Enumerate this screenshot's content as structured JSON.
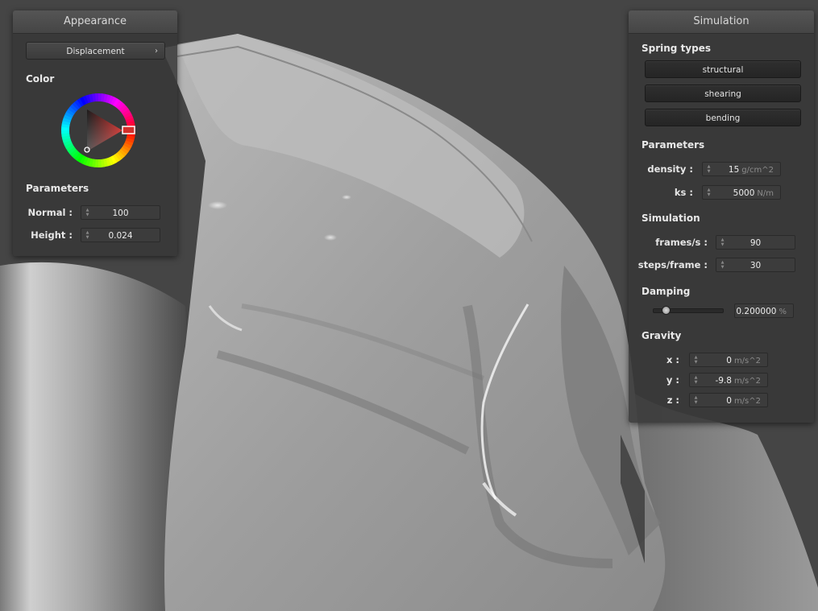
{
  "appearance": {
    "title": "Appearance",
    "shader_select": "Displacement",
    "color_label": "Color",
    "parameters_label": "Parameters",
    "normal_label": "Normal :",
    "normal_value": "100",
    "height_label": "Height :",
    "height_value": "0.024"
  },
  "simulation": {
    "title": "Simulation",
    "spring_types_label": "Spring types",
    "spring_buttons": [
      "structural",
      "shearing",
      "bending"
    ],
    "parameters_label": "Parameters",
    "density_label": "density :",
    "density_value": "15",
    "density_unit": "g/cm^2",
    "ks_label": "ks :",
    "ks_value": "5000",
    "ks_unit": "N/m",
    "simulation_label": "Simulation",
    "fps_label": "frames/s :",
    "fps_value": "90",
    "steps_label": "steps/frame :",
    "steps_value": "30",
    "damping_label": "Damping",
    "damping_value": "0.200000",
    "damping_unit": "%",
    "damping_fraction": 0.2,
    "gravity_label": "Gravity",
    "gx_label": "x :",
    "gx_value": "0",
    "gy_label": "y :",
    "gy_value": "-9.8",
    "gz_label": "z :",
    "gz_value": "0",
    "gravity_unit": "m/s^2"
  },
  "colors": {
    "background": "#454545",
    "selected_color": "#c8302e"
  },
  "icons": {
    "chevron": "chevron-right-icon",
    "spin": "spinner-arrows-icon"
  }
}
